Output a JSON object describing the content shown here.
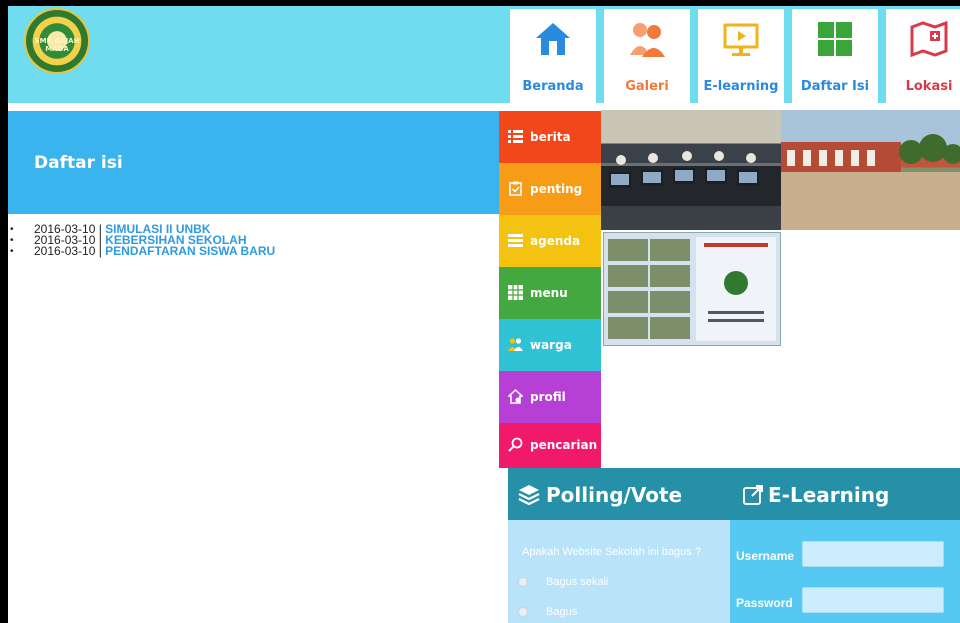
{
  "logo": {
    "text": "SMK GAJAH MADA"
  },
  "nav": [
    {
      "label": "Beranda",
      "icon": "house-icon",
      "color": "#2a8ae0"
    },
    {
      "label": "Galeri",
      "icon": "people-icon",
      "color": "#f07a3a"
    },
    {
      "label": "E-learning",
      "icon": "monitor-icon",
      "color": "#f0b41a"
    },
    {
      "label": "Daftar Isi",
      "icon": "grid-icon",
      "color": "#3aa63a"
    },
    {
      "label": "Lokasi",
      "icon": "map-icon",
      "color": "#d93a4a"
    }
  ],
  "left": {
    "title": "Daftar isi",
    "items": [
      {
        "date": "2016-03-10 | ",
        "title": "SIMULASI II UNBK"
      },
      {
        "date": "2016-03-10 | ",
        "title": "KEBERSIHAN SEKOLAH"
      },
      {
        "date": "2016-03-10 | ",
        "title": "PENDAFTARAN SISWA BARU"
      }
    ]
  },
  "categories": [
    {
      "label": "berita",
      "icon": "list-icon",
      "color": "#f2471a"
    },
    {
      "label": "penting",
      "icon": "clipboard-icon",
      "color": "#f79c16"
    },
    {
      "label": "agenda",
      "icon": "agenda-icon",
      "color": "#f4c211"
    },
    {
      "label": "menu",
      "icon": "menu-icon",
      "color": "#43a83f"
    },
    {
      "label": "warga",
      "icon": "users-icon",
      "color": "#2fc3d5"
    },
    {
      "label": "profil",
      "icon": "home-profile-icon",
      "color": "#b63fd6"
    },
    {
      "label": "pencarian",
      "icon": "search-icon",
      "color": "#f0196a"
    }
  ],
  "poll": {
    "title": "Polling/Vote",
    "question": "Apakah Website Sekolah ini bagus ?",
    "options": [
      "Bagus sekali",
      "Bagus"
    ]
  },
  "elearning": {
    "title": "E-Learning",
    "username_label": "Username",
    "password_label": "Password"
  }
}
